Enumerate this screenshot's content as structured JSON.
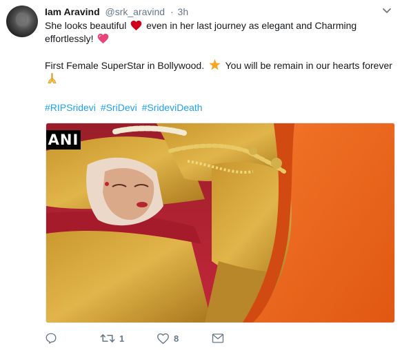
{
  "tweet": {
    "author_name": "Iam Aravind",
    "handle": "@srk_aravind",
    "separator": "·",
    "time": "3h",
    "text_line1a": "She looks beautiful",
    "text_line1b": "even in her last journey as elegant and Charming",
    "text_line2": "effortlessly!",
    "text_line3a": "First Female SuperStar in Bollywood.",
    "text_line3b": "You will be remain in our hearts forever",
    "hashtags": [
      "#RIPSridevi",
      "#SriDevi",
      "#SrideviDeath"
    ],
    "media_watermark": "ANI"
  },
  "actions": {
    "reply_count": "",
    "retweet_count": "1",
    "like_count": "8"
  },
  "icons": {
    "emoji_1": "red-heart-icon",
    "emoji_2": "pink-heart-icon",
    "emoji_3": "star-icon",
    "emoji_4": "folded-hands-icon"
  },
  "colors": {
    "link": "#1da1f2",
    "muted": "#657786",
    "text": "#14171a"
  }
}
